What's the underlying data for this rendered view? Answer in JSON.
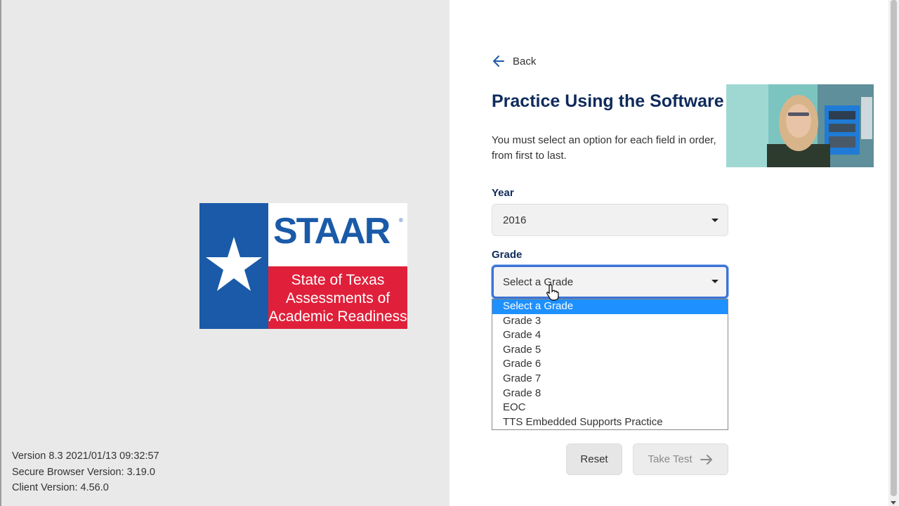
{
  "logo": {
    "word": "STAAR",
    "lines": [
      "State of Texas",
      "Assessments of",
      "Academic Readiness"
    ]
  },
  "version_info": {
    "version": "Version 8.3 2021/01/13 09:32:57",
    "secure_browser": "Secure Browser Version: 3.19.0",
    "client": "Client Version: 4.56.0"
  },
  "back": {
    "label": "Back"
  },
  "page": {
    "title": "Practice Using the Software",
    "instructions": "You must select an option for each field in order, from first to last."
  },
  "fields": {
    "year": {
      "label": "Year",
      "value": "2016"
    },
    "grade": {
      "label": "Grade",
      "value": "Select a Grade"
    }
  },
  "grade_options": [
    "Select a Grade",
    "Grade 3",
    "Grade 4",
    "Grade 5",
    "Grade 6",
    "Grade 7",
    "Grade 8",
    "EOC",
    "TTS Embedded Supports Practice"
  ],
  "buttons": {
    "reset": "Reset",
    "take_test": "Take Test"
  },
  "colors": {
    "title": "#0f2a5c",
    "accent_blue": "#1a5aa8",
    "logo_red": "#e0203a",
    "selection": "#1e90ff",
    "focus_ring": "#3b73d6"
  }
}
